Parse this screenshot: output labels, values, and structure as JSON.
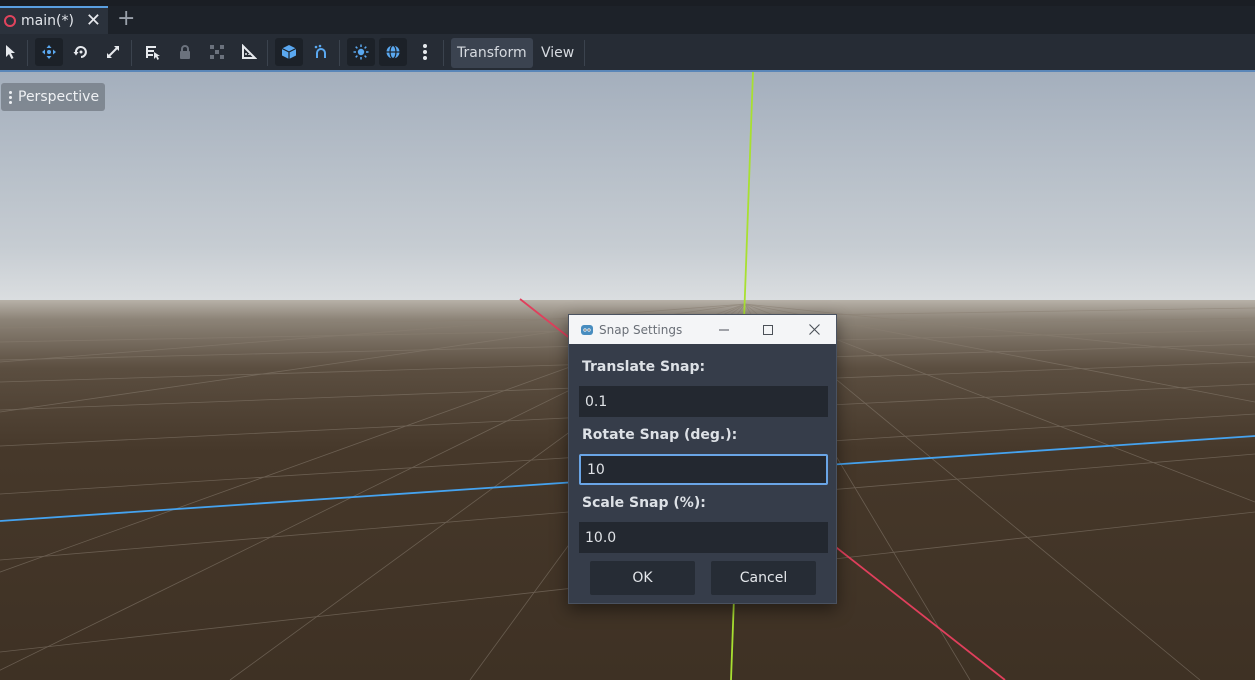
{
  "tabs": [
    {
      "label": "main(*)",
      "icon": "scene-icon",
      "accent": "#e0445d"
    }
  ],
  "toolbar": {
    "tools": [
      "select-icon",
      "move-icon",
      "rotate-icon",
      "scale-icon",
      "list-select-icon",
      "lock-icon",
      "group-icon",
      "ruler-icon",
      "local-space-icon",
      "snap-icon",
      "sun-icon",
      "environment-icon",
      "more-icon"
    ],
    "menus": {
      "transform": "Transform",
      "view": "View"
    }
  },
  "viewport": {
    "view_label": "Perspective",
    "axis_colors": {
      "x": "#e03f5c",
      "y": "#a8e031",
      "z": "#45a3f0"
    }
  },
  "dialog": {
    "title": "Snap Settings",
    "translate_label": "Translate Snap:",
    "translate_value": "0.1",
    "rotate_label": "Rotate Snap (deg.):",
    "rotate_value": "10",
    "scale_label": "Scale Snap (%):",
    "scale_value": "10.0",
    "ok_label": "OK",
    "cancel_label": "Cancel"
  }
}
